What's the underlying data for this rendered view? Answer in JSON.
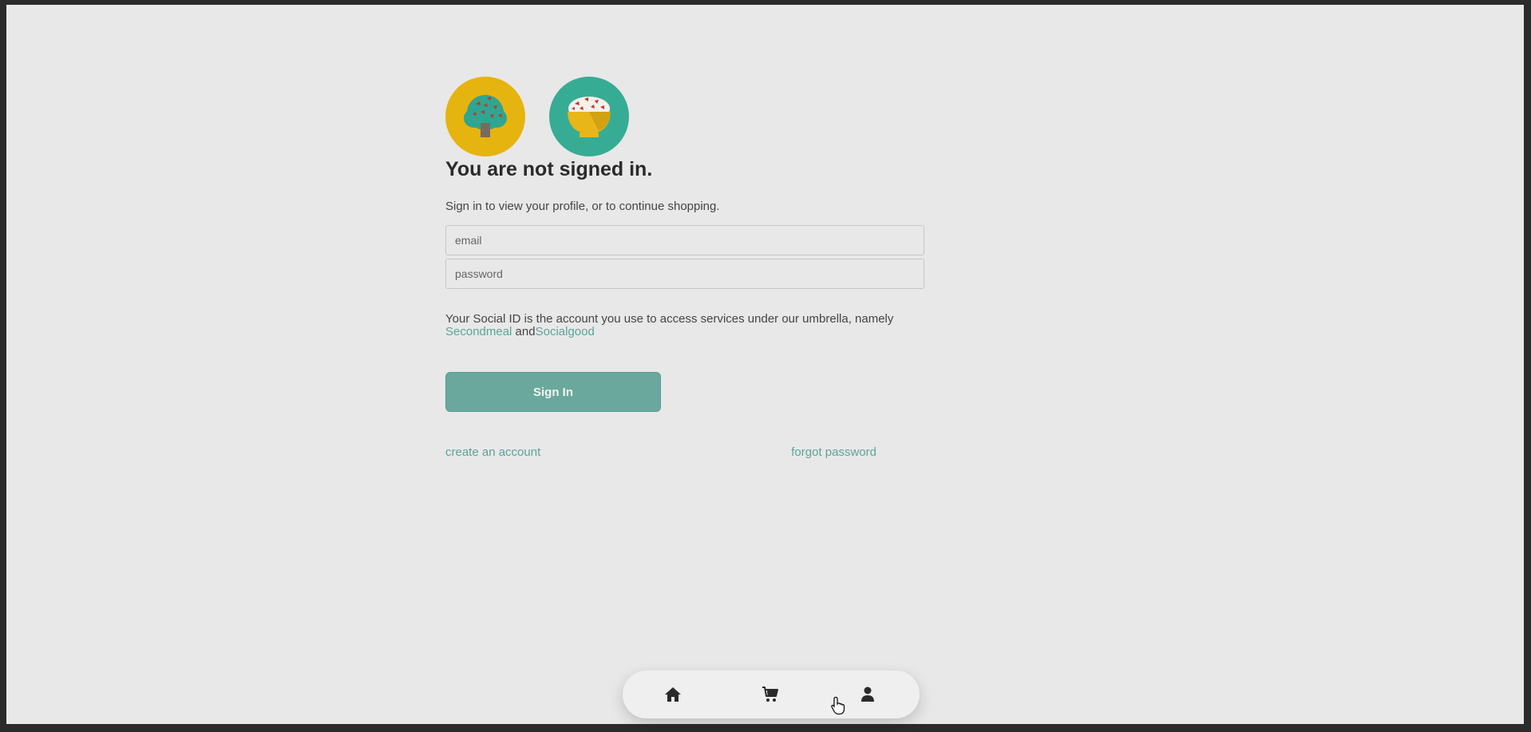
{
  "page": {
    "title": "You are not signed in.",
    "subtitle": "Sign in to view your profile, or to continue shopping."
  },
  "form": {
    "email_placeholder": "email",
    "password_placeholder": "password",
    "email_value": "",
    "password_value": ""
  },
  "info": {
    "text": "Your Social ID is the account you use to access services under our umbrella, namely ",
    "link_secondmeal": "Secondmeal",
    "and": " and",
    "link_socialgood": "Socialgood"
  },
  "actions": {
    "signin_label": "Sign In",
    "create_account": "create an account",
    "forgot_password": "forgot password"
  },
  "logos": {
    "tree": "tree-logo",
    "bowl": "rice-bowl-logo"
  },
  "nav": {
    "items": [
      {
        "icon": "home-icon"
      },
      {
        "icon": "cart-icon"
      },
      {
        "icon": "user-icon"
      }
    ]
  },
  "colors": {
    "accent": "#6aa89e",
    "link": "#5ba499",
    "logo_yellow": "#e6b40e",
    "logo_teal": "#37ac94",
    "background": "#e8e8e8"
  }
}
